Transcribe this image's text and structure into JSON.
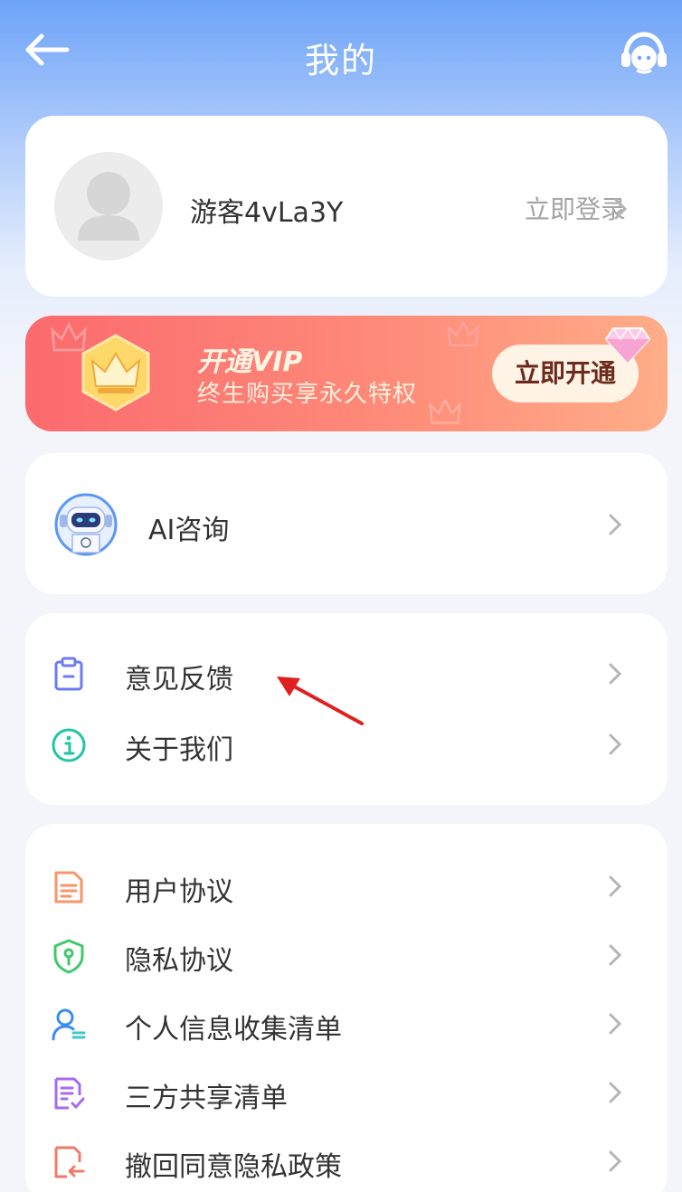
{
  "header": {
    "title": "我的",
    "back_icon": "arrow-left-icon",
    "service_icon": "headset-service-icon"
  },
  "profile": {
    "username": "游客4vLa3Y",
    "login_label": "立即登录"
  },
  "vip": {
    "title": "开通VIP",
    "subtitle": "终生购买享永久特权",
    "button_label": "立即开通",
    "colors": {
      "start": "#fb6a6e",
      "end": "#ffad88"
    }
  },
  "ai": {
    "label": "AI咨询",
    "icon": "robot-icon"
  },
  "group2": [
    {
      "label": "意见反馈",
      "icon": "clipboard-icon"
    },
    {
      "label": "关于我们",
      "icon": "info-icon"
    }
  ],
  "group3": [
    {
      "label": "用户协议",
      "icon": "document-icon"
    },
    {
      "label": "隐私协议",
      "icon": "shield-icon"
    },
    {
      "label": "个人信息收集清单",
      "icon": "user-list-icon"
    },
    {
      "label": "三方共享清单",
      "icon": "checklist-icon"
    },
    {
      "label": "撤回同意隐私政策",
      "icon": "revoke-document-icon"
    }
  ],
  "annotation": {
    "type": "red-arrow",
    "color": "#e02020"
  }
}
